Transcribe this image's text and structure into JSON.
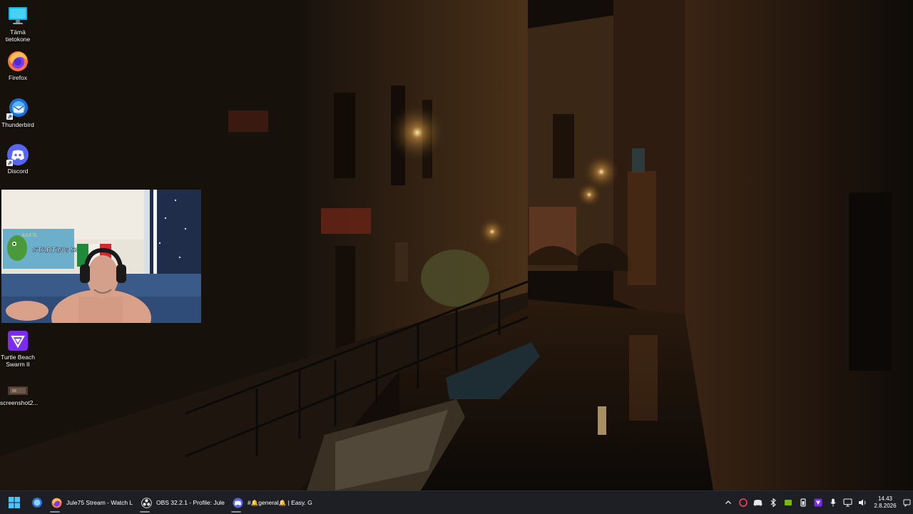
{
  "desktop": {
    "icons": [
      {
        "name": "this-pc",
        "label": "Tämä tietokone",
        "icon": "monitor-icon"
      },
      {
        "name": "firefox",
        "label": "Firefox",
        "icon": "firefox-icon"
      },
      {
        "name": "thunderbird",
        "label": "Thunderbird",
        "icon": "thunderbird-icon"
      },
      {
        "name": "discord",
        "label": "Discord",
        "icon": "discord-icon"
      },
      {
        "name": "turtle-beach",
        "label": "Turtle Beach Swarm II",
        "icon": "turtle-beach-icon"
      },
      {
        "name": "screenshot",
        "label": "screenshot2...",
        "icon": "image-file-icon"
      }
    ],
    "webcam": {
      "poster_text": "STARTING SOON",
      "poster_top": "JULE75"
    }
  },
  "taskbar": {
    "apps": [
      {
        "name": "firefox-window",
        "label": "Jule75 Stream - Watch L",
        "icon": "firefox-icon"
      },
      {
        "name": "obs-window",
        "label": "OBS 32.2.1 - Profile: Jule",
        "icon": "obs-icon"
      },
      {
        "name": "discord-window",
        "label": "#🔔general🔔 | Easy. G",
        "icon": "discord-icon"
      }
    ],
    "clock": {
      "time": "14.43",
      "date": "2.8.2026"
    }
  },
  "colors": {
    "taskbar_bg": "#1d1f24",
    "discord": "#5865f2",
    "turtle_beach": "#7b2cf0"
  }
}
